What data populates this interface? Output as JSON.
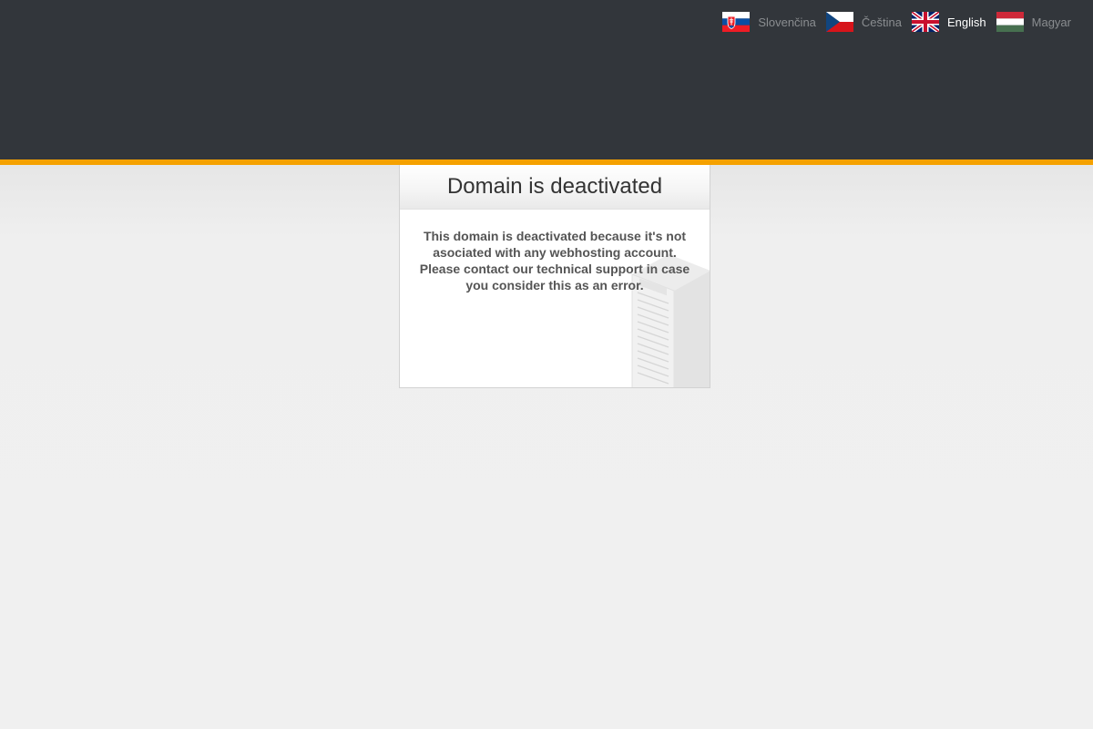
{
  "header": {
    "languages": [
      {
        "code": "sk",
        "label": "Slovenčina",
        "flag_icon": "slovakia-flag-icon",
        "active": false
      },
      {
        "code": "cs",
        "label": "Čeština",
        "flag_icon": "czech-flag-icon",
        "active": false
      },
      {
        "code": "en",
        "label": "English",
        "flag_icon": "uk-flag-icon",
        "active": true
      },
      {
        "code": "hu",
        "label": "Magyar",
        "flag_icon": "hungary-flag-icon",
        "active": false
      }
    ]
  },
  "card": {
    "title": "Domain is deactivated",
    "message": "This domain is deactivated because it's not asociated with any webhosting account. Please contact our technical support in case you consider this as an error.",
    "illustration_icon": "server-rack-icon"
  },
  "colors": {
    "header_bg": "#32363b",
    "accent": "#f5a100",
    "inactive_lang_text": "#8a8d90",
    "active_lang_text": "#ffffff",
    "message_text": "#555555",
    "title_text": "#333333"
  }
}
